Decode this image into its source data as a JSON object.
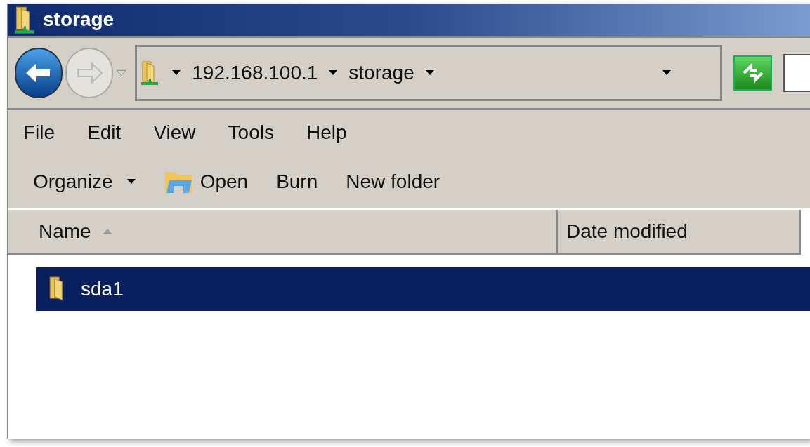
{
  "window": {
    "title": "storage"
  },
  "address": {
    "segments": [
      "192.168.100.1",
      "storage"
    ]
  },
  "menu": [
    "File",
    "Edit",
    "View",
    "Tools",
    "Help"
  ],
  "toolbar": [
    {
      "label": "Organize",
      "kind": "menu"
    },
    {
      "label": "Open",
      "kind": "open"
    },
    {
      "label": "Burn",
      "kind": "plain"
    },
    {
      "label": "New folder",
      "kind": "plain"
    }
  ],
  "columns": [
    {
      "label": "Name",
      "sorted": true
    },
    {
      "label": "Date modified",
      "sorted": false
    }
  ],
  "rows": [
    {
      "name": "sda1",
      "selected": true
    }
  ]
}
